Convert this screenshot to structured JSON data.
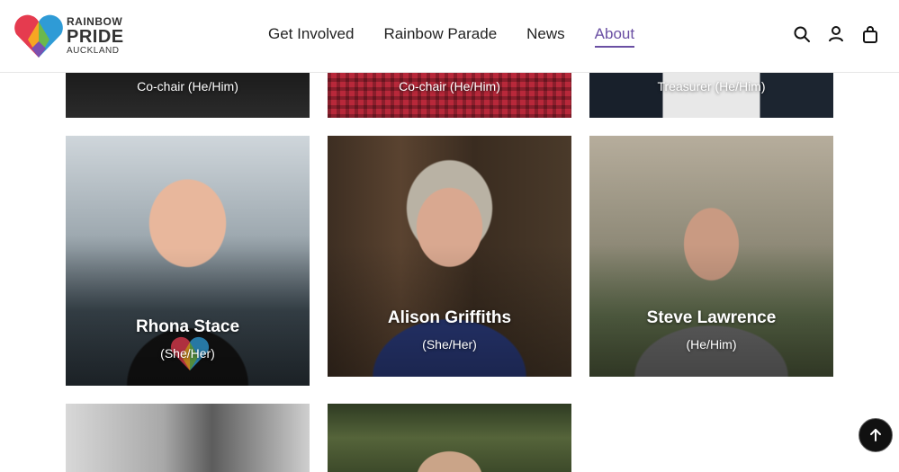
{
  "logo": {
    "line1": "RAINBOW",
    "line2": "PRIDE",
    "line3": "AUCKLAND"
  },
  "nav": [
    {
      "label": "Get Involved"
    },
    {
      "label": "Rainbow Parade"
    },
    {
      "label": "News"
    },
    {
      "label": "About",
      "active": true
    }
  ],
  "header_icons": [
    "search-icon",
    "user-icon",
    "shopping-bag-icon"
  ],
  "cards": [
    {
      "name": "",
      "role": "Co-chair (He/Him)"
    },
    {
      "name": "",
      "role": "Co-chair (He/Him)"
    },
    {
      "name": "",
      "role": "Treasurer (He/Him)"
    },
    {
      "name": "Rhona Stace",
      "role": "(She/Her)"
    },
    {
      "name": "Alison Griffiths",
      "role": "(She/Her)"
    },
    {
      "name": "Steve Lawrence",
      "role": "(He/Him)"
    }
  ],
  "colors": {
    "accent": "#6a4fa3",
    "text": "#222222"
  }
}
